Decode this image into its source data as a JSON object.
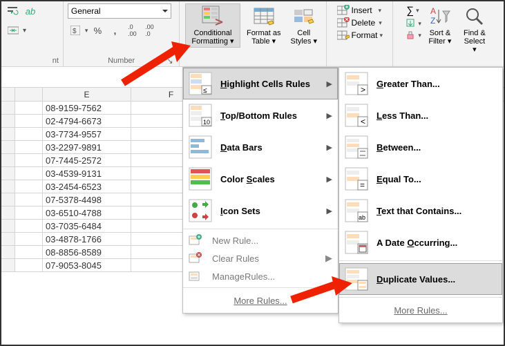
{
  "ribbon": {
    "alignment_label": "nt",
    "number_label": "Number",
    "number_format": "General",
    "btn_conditional_l1": "Conditional",
    "btn_conditional_l2": "Formatting",
    "btn_formatas_l1": "Format as",
    "btn_formatas_l2": "Table",
    "btn_cellstyles_l1": "Cell",
    "btn_cellstyles_l2": "Styles",
    "cells_insert": "Insert",
    "cells_delete": "Delete",
    "cells_format": "Format",
    "sort_l1": "Sort &",
    "sort_l2": "Filter",
    "find_l1": "Find &",
    "find_l2": "Select"
  },
  "columns": {
    "e": "E",
    "f": "F"
  },
  "rows": [
    "08-9159-7562",
    "02-4794-6673",
    "03-7734-9557",
    "03-2297-9891",
    "07-7445-2572",
    "03-4539-9131",
    "03-2454-6523",
    "07-5378-4498",
    "03-6510-4788",
    "03-7035-6484",
    "03-4878-1766",
    "08-8856-8589",
    "07-9053-8045"
  ],
  "cf_menu": {
    "highlight": "Highlight Cells Rules",
    "topbottom": "Top/Bottom Rules",
    "databars": "Data Bars",
    "colorscales": "Color Scales",
    "iconsets": "Icon Sets",
    "newrule": "New Rule...",
    "clear": "Clear Rules",
    "manage": "Manage Rules...",
    "more": "More Rules..."
  },
  "hcr_menu": {
    "gt": "Greater Than...",
    "lt": "Less Than...",
    "between": "Between...",
    "eq": "Equal To...",
    "text": "Text that Contains...",
    "date": "A Date Occurring...",
    "dup": "Duplicate Values...",
    "more": "More Rules..."
  }
}
